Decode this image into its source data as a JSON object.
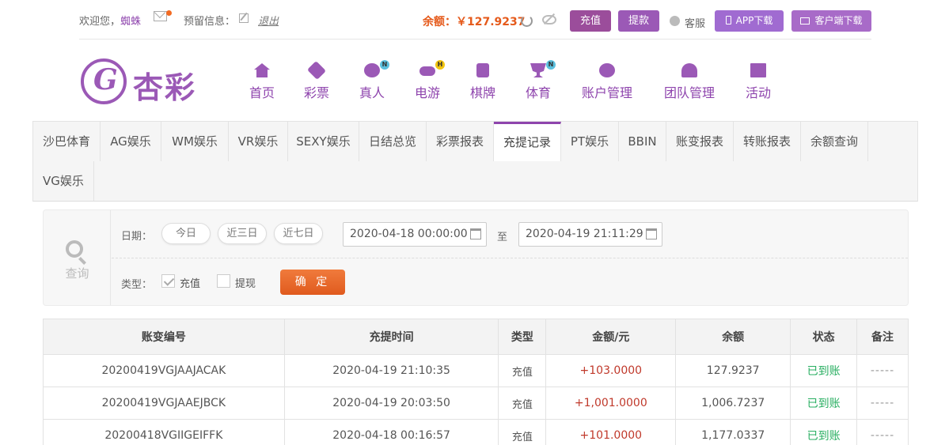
{
  "topbar": {
    "welcome": "欢迎您，",
    "username": "蜘蛛",
    "reserved_label": "预留信息：",
    "logout": "退出",
    "balance_label": "余额：",
    "balance_value": "￥127.9237",
    "charge_btn": "充值",
    "withdraw_btn": "提款",
    "service": "客服",
    "app_download": "APP下载",
    "client_download": "客户端下载"
  },
  "logo": {
    "text": "杏彩"
  },
  "nav": [
    {
      "label": "首页",
      "icon": "home-icon",
      "badge": ""
    },
    {
      "label": "彩票",
      "icon": "lottery-ticket-icon",
      "badge": ""
    },
    {
      "label": "真人",
      "icon": "live-dealer-icon",
      "badge": "N"
    },
    {
      "label": "电游",
      "icon": "gamepad-icon",
      "badge": "H"
    },
    {
      "label": "棋牌",
      "icon": "cards-icon",
      "badge": ""
    },
    {
      "label": "体育",
      "icon": "trophy-icon",
      "badge": "N"
    },
    {
      "label": "账户管理",
      "icon": "account-coin-icon",
      "badge": ""
    },
    {
      "label": "团队管理",
      "icon": "team-icon",
      "badge": ""
    },
    {
      "label": "活动",
      "icon": "gift-icon",
      "badge": ""
    }
  ],
  "tabs": [
    {
      "label": "沙巴体育",
      "active": false
    },
    {
      "label": "AG娱乐",
      "active": false
    },
    {
      "label": "WM娱乐",
      "active": false
    },
    {
      "label": "VR娱乐",
      "active": false
    },
    {
      "label": "SEXY娱乐",
      "active": false
    },
    {
      "label": "日结总览",
      "active": false
    },
    {
      "label": "彩票报表",
      "active": false
    },
    {
      "label": "充提记录",
      "active": true
    },
    {
      "label": "PT娱乐",
      "active": false
    },
    {
      "label": "BBIN",
      "active": false
    },
    {
      "label": "账变报表",
      "active": false
    },
    {
      "label": "转账报表",
      "active": false
    },
    {
      "label": "余额查询",
      "active": false
    },
    {
      "label": "VG娱乐",
      "active": false
    }
  ],
  "filter": {
    "query_label": "查询",
    "date_label": "日期：",
    "quick_ranges": [
      "今日",
      "近三日",
      "近七日"
    ],
    "start_date": "2020-04-18 00:00:00",
    "to_label": "至",
    "end_date": "2020-04-19 21:11:29",
    "type_label": "类型：",
    "type_options": [
      {
        "label": "充值",
        "checked": true
      },
      {
        "label": "提现",
        "checked": false
      }
    ],
    "confirm_btn": "确 定"
  },
  "table": {
    "headers": [
      "账变编号",
      "充提时间",
      "类型",
      "金额/元",
      "余额",
      "状态",
      "备注"
    ],
    "rows": [
      [
        "20200419VGJAAJACAK",
        "2020-04-19 21:10:35",
        "充值",
        "+103.0000",
        "127.9237",
        "已到账",
        "-----"
      ],
      [
        "20200419VGJAAEJBCK",
        "2020-04-19 20:03:50",
        "充值",
        "+1,001.0000",
        "1,006.7237",
        "已到账",
        "-----"
      ],
      [
        "20200418VGIIGEIFFK",
        "2020-04-18 00:16:57",
        "充值",
        "+101.0000",
        "1,177.0337",
        "已到账",
        "-----"
      ]
    ]
  },
  "colors": {
    "brand_purple": "#9b59b6",
    "accent_orange": "#e55a1b",
    "amount_red": "#c0392b",
    "status_green": "#27ae60"
  }
}
